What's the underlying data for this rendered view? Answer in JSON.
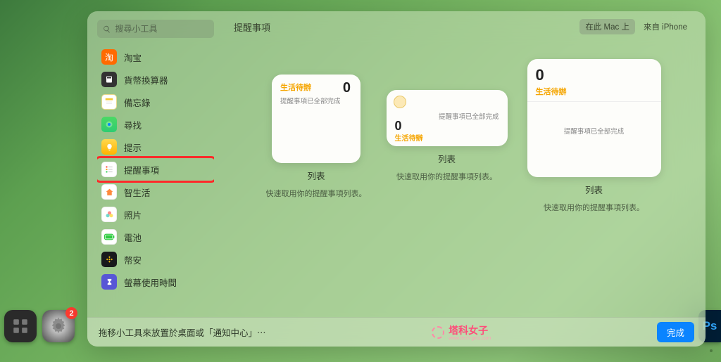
{
  "search": {
    "placeholder": "搜尋小工具"
  },
  "sidebar": {
    "items": [
      {
        "label": "淘宝"
      },
      {
        "label": "貨幣換算器"
      },
      {
        "label": "備忘錄"
      },
      {
        "label": "尋找"
      },
      {
        "label": "提示"
      },
      {
        "label": "提醒事項"
      },
      {
        "label": "智生活"
      },
      {
        "label": "照片"
      },
      {
        "label": "電池"
      },
      {
        "label": "幣安"
      },
      {
        "label": "螢幕使用時間"
      }
    ]
  },
  "main": {
    "title": "提醒事項",
    "source_local": "在此 Mac 上",
    "source_remote": "來自 iPhone"
  },
  "widgets": {
    "list_name": "生活待辦",
    "count": "0",
    "done_text": "提醒事項已全部完成",
    "caption_title": "列表",
    "caption_sub": "快速取用你的提醒事項列表。"
  },
  "footer": {
    "hint": "拖移小工具來放置於桌面或「通知中心」⋯",
    "done": "完成"
  },
  "watermark": {
    "name": "塔科女子",
    "sub": "www.tech-girlz.com"
  },
  "dock": {
    "settings_badge": "2",
    "ps": "Ps"
  }
}
